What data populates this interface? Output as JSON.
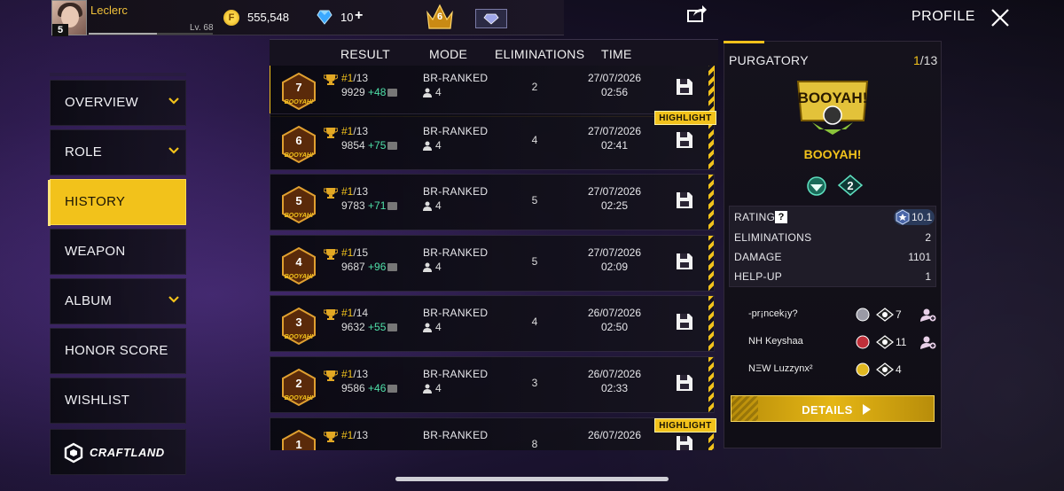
{
  "player": {
    "name": "Leclerc",
    "level": "Lv. 68",
    "badge": "5",
    "xp_fraction": 0.55
  },
  "currency": {
    "coin_symbol": "F",
    "coins": "555,548",
    "diamonds": "10",
    "plus": "+",
    "rank_number": "6"
  },
  "header": {
    "profile_label": "PROFILE"
  },
  "sidebar": {
    "items": [
      {
        "label": "OVERVIEW",
        "has_chevron": true,
        "active": false
      },
      {
        "label": "ROLE",
        "has_chevron": true,
        "active": false
      },
      {
        "label": "HISTORY",
        "has_chevron": false,
        "active": true
      },
      {
        "label": "WEAPON",
        "has_chevron": false,
        "active": false
      },
      {
        "label": "ALBUM",
        "has_chevron": true,
        "active": false
      },
      {
        "label": "HONOR SCORE",
        "has_chevron": false,
        "active": false
      },
      {
        "label": "WISHLIST",
        "has_chevron": false,
        "active": false
      }
    ],
    "craftland": "CRAFTLAND"
  },
  "table": {
    "headers": {
      "result": "RESULT",
      "mode": "MODE",
      "eliminations": "ELIMINATIONS",
      "time": "TIME"
    },
    "highlight_label": "HIGHLIGHT",
    "rows": [
      {
        "badge": "7",
        "badge_text": "BOOYAH!",
        "rank": "#1",
        "total": "/13",
        "score": "9929",
        "delta": "+48",
        "mode": "BR-RANKED",
        "squad": "4",
        "elims": "2",
        "date": "27/07/2026",
        "time": "02:56"
      },
      {
        "badge": "6",
        "badge_text": "BOOYAH!",
        "rank": "#1",
        "total": "/13",
        "score": "9854",
        "delta": "+75",
        "mode": "BR-RANKED",
        "squad": "4",
        "elims": "4",
        "date": "27/07/2026",
        "time": "02:41"
      },
      {
        "badge": "5",
        "badge_text": "BOOYAH!",
        "rank": "#1",
        "total": "/13",
        "score": "9783",
        "delta": "+71",
        "mode": "BR-RANKED",
        "squad": "4",
        "elims": "5",
        "date": "27/07/2026",
        "time": "02:25"
      },
      {
        "badge": "4",
        "badge_text": "BOOYAH!",
        "rank": "#1",
        "total": "/15",
        "score": "9687",
        "delta": "+96",
        "mode": "BR-RANKED",
        "squad": "4",
        "elims": "5",
        "date": "27/07/2026",
        "time": "02:09"
      },
      {
        "badge": "3",
        "badge_text": "BOOYAH!",
        "rank": "#1",
        "total": "/14",
        "score": "9632",
        "delta": "+55",
        "mode": "BR-RANKED",
        "squad": "4",
        "elims": "4",
        "date": "26/07/2026",
        "time": "02:50"
      },
      {
        "badge": "2",
        "badge_text": "BOOYAH!",
        "rank": "#1",
        "total": "/13",
        "score": "9586",
        "delta": "+46",
        "mode": "BR-RANKED",
        "squad": "4",
        "elims": "3",
        "date": "26/07/2026",
        "time": "02:33"
      },
      {
        "badge": "1",
        "badge_text": "",
        "rank": "#1",
        "total": "/13",
        "score": "",
        "delta": "",
        "mode": "BR-RANKED",
        "squad": "",
        "elims": "8",
        "date": "26/07/2026",
        "time": ""
      }
    ]
  },
  "detail": {
    "map": "PURGATORY",
    "page_current": "1",
    "page_total": "/13",
    "logo_text": "BOOYAH!",
    "result": "BOOYAH!",
    "medal_count": "2",
    "stats": {
      "rating_label": "RATING",
      "rating_help": "?",
      "rating_value": "10.1",
      "elims_label": "ELIMINATIONS",
      "elims_value": "2",
      "damage_label": "DAMAGE",
      "damage_value": "1101",
      "helpup_label": "HELP-UP",
      "helpup_value": "1"
    },
    "team": [
      {
        "name": "-pr¡ncek¡y?",
        "kills": "7",
        "rank_color": "#9a9aa6"
      },
      {
        "name": "NH   Keyshaa",
        "kills": "11",
        "rank_color": "#c0303a"
      },
      {
        "name": "NΞW  Luzzynx²",
        "kills": "4",
        "rank_color": "#e0b820"
      }
    ],
    "details_button": "DETAILS"
  },
  "colors": {
    "accent": "#f2c21b",
    "positive": "#4fe0a8",
    "panel": "#15121c"
  }
}
